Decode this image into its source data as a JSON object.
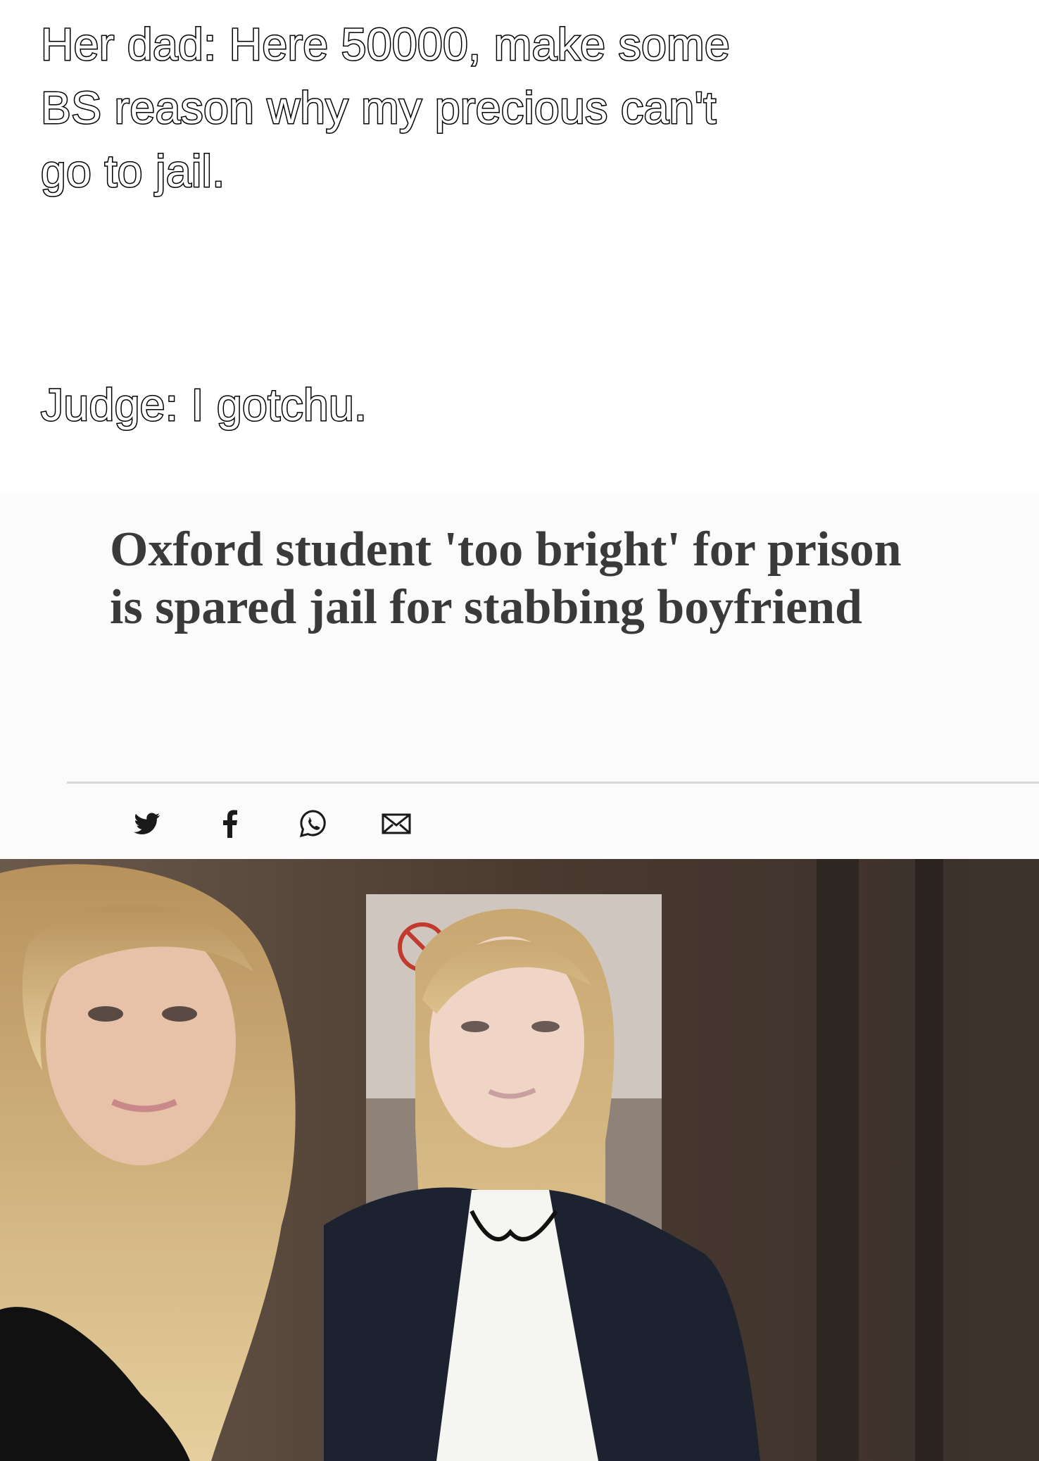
{
  "caption": {
    "dad_line": "Her dad: Here 50000, make some\nBS reason why my precious can't\ngo to jail.",
    "judge_line": "Judge: I gotchu."
  },
  "article": {
    "headline": "Oxford student 'too bright' for prison is spared jail for stabbing boyfriend",
    "share_icons": [
      "twitter-icon",
      "facebook-icon",
      "whatsapp-icon",
      "email-icon"
    ]
  },
  "colors": {
    "caption_fill": "#ffffff",
    "caption_outline": "#000000",
    "headline_text": "#3a3a3a",
    "share_icon": "#1a1a1a"
  }
}
